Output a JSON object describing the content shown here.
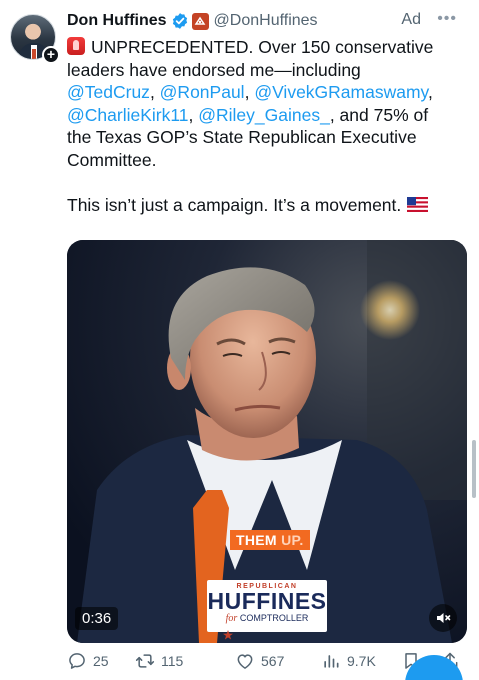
{
  "tweet": {
    "author_name": "Don Huffines",
    "handle": "@DonHuffines",
    "ad_label": "Ad",
    "line1": "UNPRECEDENTED. Over 150 conservative",
    "line2": "leaders have endorsed me—including",
    "mention_tedcruz": "@TedCruz",
    "mention_ronpaul": "@RonPaul",
    "mention_vivek": "@VivekGRamaswamy",
    "mention_charliekirk": "@CharlieKirk11",
    "mention_rileygaines": "@Riley_Gaines_",
    "line4_tail": ", and 75% of",
    "line5": "the Texas GOP’s State Republican Executive",
    "line6": "Committee.",
    "line7": "This isn’t just a campaign. It’s a movement."
  },
  "video": {
    "caption_them": "THEM",
    "caption_up": "UP.",
    "logo_republican": "REPUBLICAN",
    "logo_name": "HUFFINES",
    "logo_for": "for",
    "logo_office": "COMPTROLLER",
    "timestamp": "0:36"
  },
  "stats": {
    "replies": "25",
    "retweets": "115",
    "likes": "567",
    "views": "9.7K"
  },
  "colors": {
    "accent": "#1d9bf0",
    "text": "#0f1419",
    "secondary": "#536471",
    "caption_orange": "#f26a21"
  },
  "icons": [
    "verified-badge-icon",
    "affiliate-badge-icon",
    "more-icon",
    "siren-icon",
    "us-flag-icon",
    "mute-icon",
    "reply-icon",
    "retweet-icon",
    "like-icon",
    "views-icon",
    "bookmark-icon",
    "share-icon",
    "follow-plus-icon"
  ]
}
